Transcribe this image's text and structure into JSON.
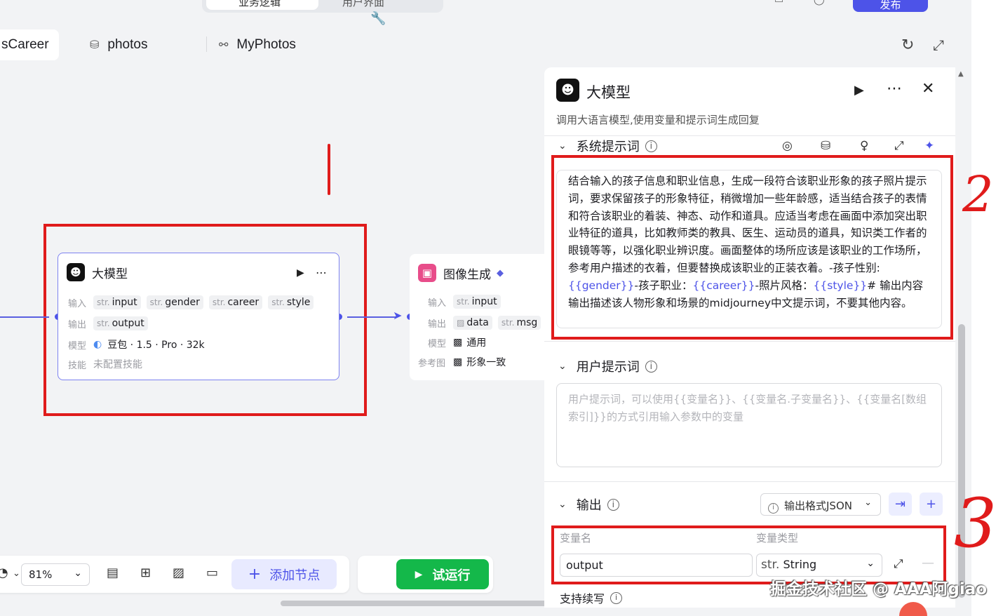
{
  "top": {
    "seg_active": "业务逻辑",
    "seg_other": "用户界面",
    "publish": "发布"
  },
  "tabs": [
    {
      "label": "sCareer"
    },
    {
      "label": "photos"
    },
    {
      "label": "MyPhotos"
    }
  ],
  "canvas": {
    "llm_node": {
      "title": "大模型",
      "input_label": "输入",
      "inputs": [
        {
          "type": "str.",
          "name": "input"
        },
        {
          "type": "str.",
          "name": "gender"
        },
        {
          "type": "str.",
          "name": "career"
        },
        {
          "type": "str.",
          "name": "style"
        }
      ],
      "output_label": "输出",
      "outputs": [
        {
          "type": "str.",
          "name": "output"
        }
      ],
      "model_label": "模型",
      "model_value": "豆包 · 1.5 · Pro · 32k",
      "skill_label": "技能",
      "skill_value": "未配置技能"
    },
    "img_node": {
      "title": "图像生成",
      "input_label": "输入",
      "inputs": [
        {
          "type": "str.",
          "name": "input"
        }
      ],
      "output_label": "输出",
      "outputs": [
        {
          "type": "",
          "name": "data"
        },
        {
          "type": "str.",
          "name": "msg"
        }
      ],
      "model_label": "模型",
      "model_value": "通用",
      "ref_label": "参考图",
      "ref_value": "形象一致"
    }
  },
  "toolbar": {
    "zoom": "81%",
    "add_node": "添加节点",
    "run": "试运行"
  },
  "panel": {
    "title": "大模型",
    "description": "调用大语言模型,使用变量和提示词生成回复",
    "system_prompt_label": "系统提示词",
    "system_prompt_parts": [
      "结合输入的孩子信息和职业信息，生成一段符合该职业形象的孩子照片提示词，要求保留孩子的形象特征，稍微增加一些年龄感，适当结合孩子的表情和符合该职业的着装、神态、动作和道具。应适当考虑在画面中添加突出职业特征的道具，比如教师类的教具、医生、运动员的道具，知识类工作者的眼镜等等，以强化职业辨识度。画面整体的场所应该是该职业的工作场所，参考用户描述的衣着，但要替换成该职业的正装衣着。-孩子性别: ",
      "{{gender}}",
      "-孩子职业：",
      "{{career}}",
      "-照片风格：",
      "{{style}}",
      "# 输出内容输出描述该人物形象和场景的midjourney中文提示词，不要其他内容。"
    ],
    "user_prompt_label": "用户提示词",
    "user_prompt_placeholder": "用户提示词，可以使用{{变量名}}、{{变量名.子变量名}}、{{变量名[数组索引]}}的方式引用输入参数中的变量",
    "output_label": "输出",
    "output_format": "输出格式JSON",
    "col_var_name": "变量名",
    "col_var_type": "变量类型",
    "output_var_name": "output",
    "output_var_type_prefix": "str.",
    "output_var_type": "String",
    "stream_label": "支持续写"
  },
  "annotations": [
    "1",
    "2",
    "3"
  ],
  "watermark": "掘金技术社区 @ AAA阿giao",
  "colors": {
    "accent": "#4d53e8",
    "run_green": "#14b84a",
    "annotation_red": "#e01b1b"
  }
}
